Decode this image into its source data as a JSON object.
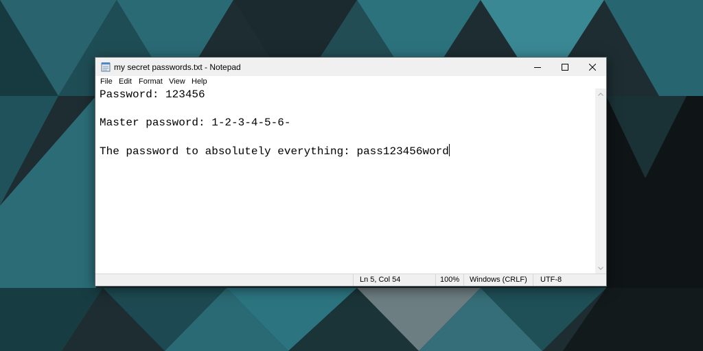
{
  "window": {
    "title": "my secret passwords.txt - Notepad",
    "controls": {
      "minimize_icon": "minimize-icon",
      "maximize_icon": "maximize-icon",
      "close_icon": "close-icon"
    }
  },
  "menu": {
    "file": "File",
    "edit": "Edit",
    "format": "Format",
    "view": "View",
    "help": "Help"
  },
  "editor": {
    "content": "Password: 123456\n\nMaster password: 1-2-3-4-5-6-\n\nThe password to absolutely everything: pass123456word"
  },
  "status": {
    "position": "Ln 5, Col 54",
    "zoom": "100%",
    "line_ending": "Windows (CRLF)",
    "encoding": "UTF-8"
  },
  "colors": {
    "titlebar": "#f0f0f0",
    "desktop_teal": "#2f7e8a",
    "desktop_dark": "#101619"
  }
}
